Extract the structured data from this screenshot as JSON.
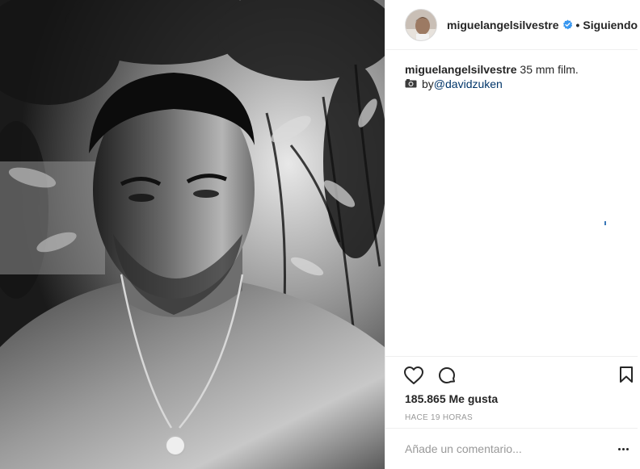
{
  "post": {
    "author": "miguelangelsilvestre",
    "verified": true,
    "follow_separator": "•",
    "follow_state": "Siguiendo"
  },
  "caption": {
    "username": "miguelangelsilvestre",
    "text": " 35 mm film.",
    "camera_icon": "camera-icon",
    "by_text": "by ",
    "mention": "@davidzuken"
  },
  "stats": {
    "likes": "185.865 Me gusta",
    "timestamp": "HACE 19 HORAS"
  },
  "comment": {
    "placeholder": "Añade un comentario...",
    "value": ""
  },
  "colors": {
    "verified_badge": "#3897f0",
    "mention": "#003569",
    "border": "#efefef",
    "muted": "#999999"
  },
  "icons": [
    "heart-icon",
    "comment-icon",
    "bookmark-icon",
    "more-options-icon",
    "verified-badge-icon"
  ]
}
